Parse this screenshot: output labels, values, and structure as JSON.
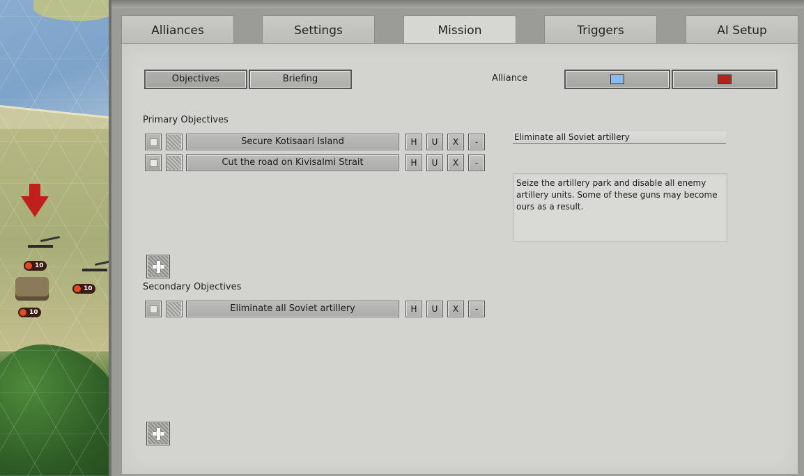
{
  "tabs": [
    {
      "label": "Alliances"
    },
    {
      "label": "Settings"
    },
    {
      "label": "Mission"
    },
    {
      "label": "Triggers"
    },
    {
      "label": "AI Setup"
    }
  ],
  "active_tab": "Mission",
  "subtabs": {
    "objectives": "Objectives",
    "briefing": "Briefing",
    "selected": "Objectives"
  },
  "alliance": {
    "label": "Alliance",
    "colors": {
      "allies": "#8ab8f0",
      "axis": "#b3231b"
    }
  },
  "primary": {
    "heading": "Primary Objectives",
    "items": [
      {
        "name": "Secure Kotisaari Island"
      },
      {
        "name": "Cut the road on Kivisalmi Strait"
      }
    ]
  },
  "secondary": {
    "heading": "Secondary Objectives",
    "items": [
      {
        "name": "Eliminate all Soviet artillery"
      }
    ]
  },
  "row_buttons": {
    "h": "H",
    "u": "U",
    "x": "X",
    "minus": "-"
  },
  "selected_objective": {
    "title": "Eliminate all Soviet artillery",
    "description": "Seize the artillery park and disable all enemy artillery units. Some of these guns may become ours as a result."
  },
  "map_units": {
    "badge_1": "10",
    "badge_2": "10",
    "badge_3": "10"
  }
}
